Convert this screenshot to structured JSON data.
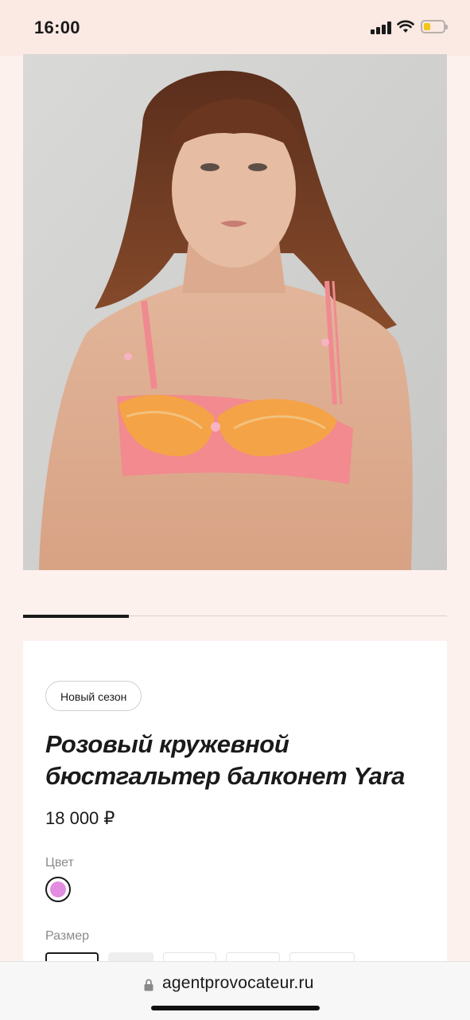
{
  "status_bar": {
    "time": "16:00",
    "icons": [
      "signal-icon",
      "wifi-icon",
      "battery-icon"
    ]
  },
  "hero": {
    "image": "product-photo",
    "description_colors": {
      "background": "#d2d2d0",
      "bra": "#f28a8f",
      "lace": "#f5a347"
    }
  },
  "gallery": {
    "active_index": 0,
    "count": 4
  },
  "product": {
    "badge": "Новый сезон",
    "title": "Розовый кружевной бюстгальтер балконет Yara",
    "price": "18 000 ₽",
    "color_label": "Цвет",
    "selected_color": "#e38de0",
    "size_label": "Размер"
  },
  "browser": {
    "url": "agentprovocateur.ru",
    "icons": [
      "lock-icon"
    ]
  },
  "colors": {
    "page_bg": "#fdf1ee",
    "card_bg": "#ffffff",
    "text": "#1a1a1a",
    "muted": "#8a8a8a"
  }
}
